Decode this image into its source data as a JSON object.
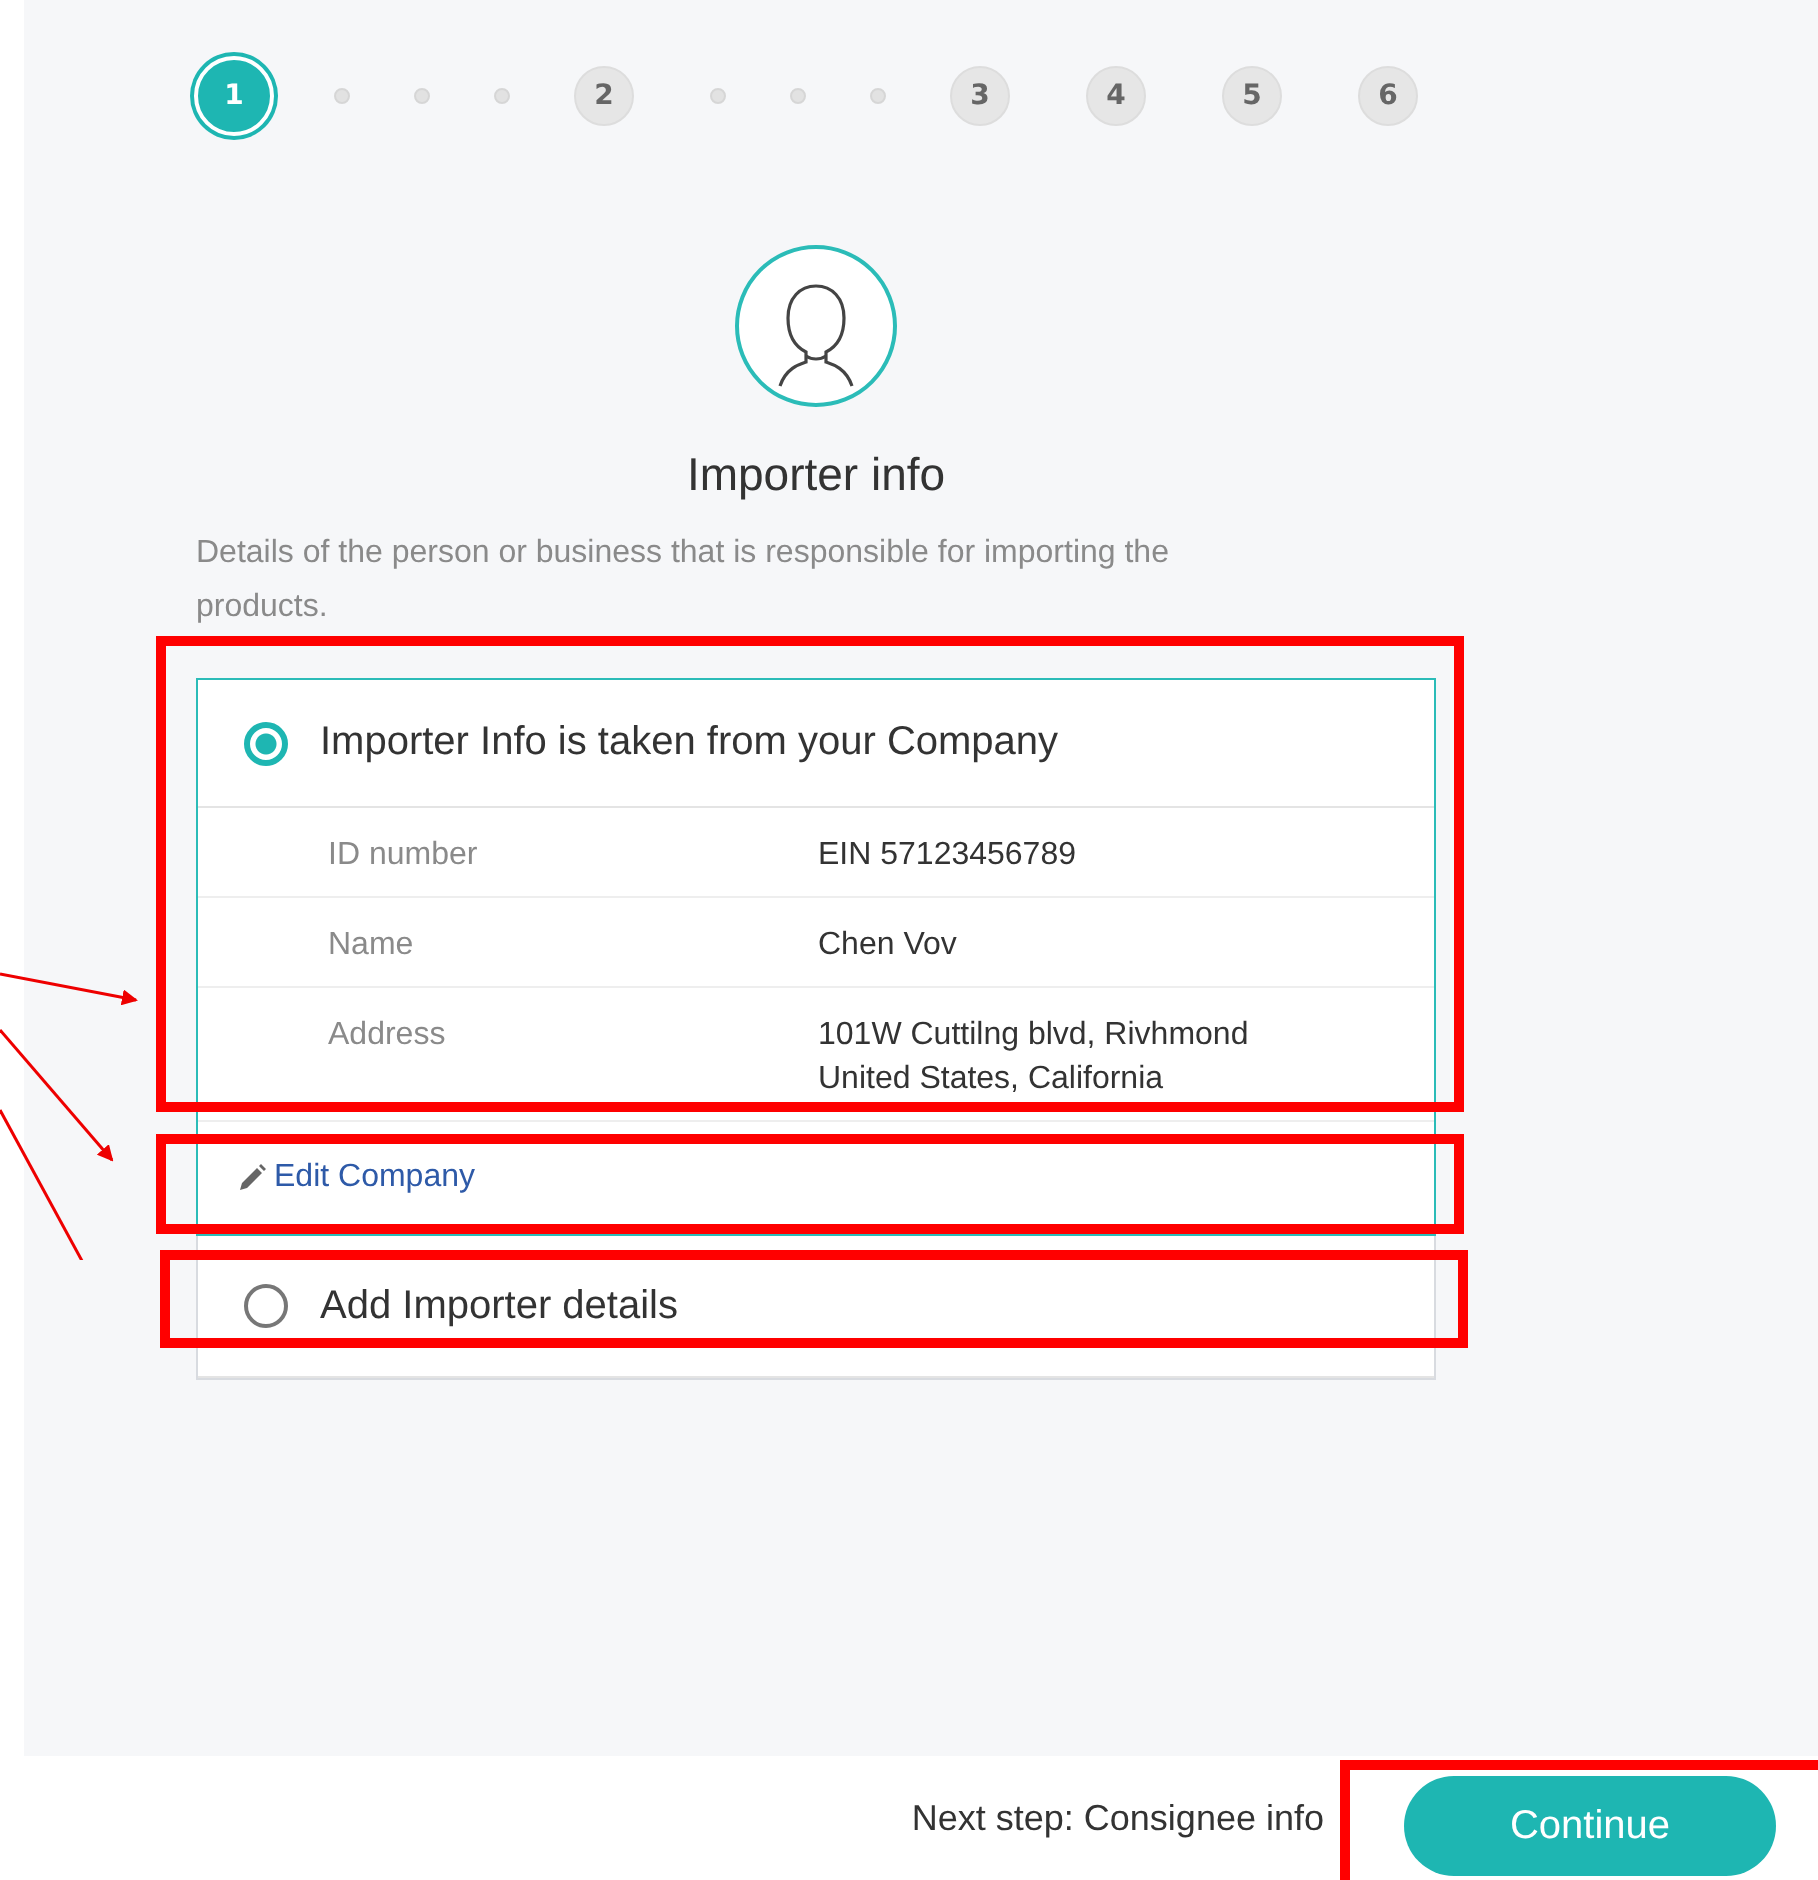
{
  "stepper": [
    {
      "kind": "step",
      "label": "1",
      "selected": true
    },
    {
      "kind": "dot"
    },
    {
      "kind": "dot"
    },
    {
      "kind": "dot"
    },
    {
      "kind": "step",
      "label": "2",
      "selected": false
    },
    {
      "kind": "dot"
    },
    {
      "kind": "dot"
    },
    {
      "kind": "dot"
    },
    {
      "kind": "step",
      "label": "3",
      "selected": false
    },
    {
      "kind": "step",
      "label": "4",
      "selected": false
    },
    {
      "kind": "step",
      "label": "5",
      "selected": false
    },
    {
      "kind": "step",
      "label": "6",
      "selected": false
    }
  ],
  "title": "Importer info",
  "description": "Details of the person or business that is responsible for importing the products.",
  "options": [
    {
      "label": "Importer Info is taken from your Company",
      "selected": true,
      "details": [
        {
          "label": "ID number",
          "value": "EIN 57123456789"
        },
        {
          "label": "Name",
          "value": "Chen Vov"
        },
        {
          "label": "Address",
          "value": "101W Cuttilng blvd, Rivhmond United States, California"
        }
      ],
      "link": "Edit Company"
    },
    {
      "label": "Add Importer details",
      "selected": false
    }
  ],
  "footer": {
    "next_step": "Next step: Consignee info",
    "button": "Continue"
  }
}
